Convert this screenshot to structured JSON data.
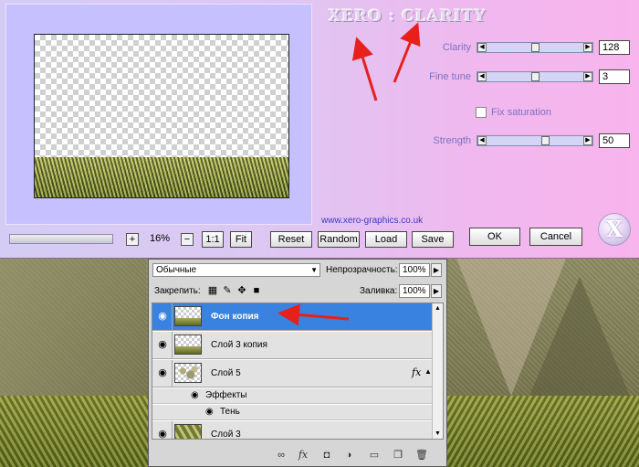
{
  "plugin": {
    "title": "XERO : CLARITY",
    "website": "www.xero-graphics.co.uk",
    "logo_letter": "X",
    "params": [
      {
        "label": "Clarity",
        "value": "128",
        "level": 0.5
      },
      {
        "label": "Fine tune",
        "value": "3",
        "level": 0.5
      },
      {
        "label": "Strength",
        "value": "50",
        "level": 0.62
      }
    ],
    "fix_saturation": {
      "label": "Fix saturation",
      "checked": false
    },
    "zoom": {
      "plus": "+",
      "value": "16%",
      "minus": "−",
      "one_to_one": "1:1",
      "fit": "Fit"
    },
    "buttons": {
      "reset": "Reset",
      "random": "Random",
      "load": "Load",
      "save": "Save",
      "ok": "OK",
      "cancel": "Cancel"
    }
  },
  "layers_panel": {
    "blend_mode": "Обычные",
    "opacity_label": "Непрозрачность:",
    "opacity_value": "100%",
    "lock_label": "Закрепить:",
    "fill_label": "Заливка:",
    "fill_value": "100%",
    "fx_label": "fx",
    "layers": [
      {
        "name": "Фон копия",
        "selected": true
      },
      {
        "name": "Слой 3 копия",
        "selected": false
      },
      {
        "name": "Слой 5",
        "selected": false,
        "has_effects": true
      },
      {
        "name": "Слой 3",
        "selected": false
      }
    ],
    "effects_label": "Эффекты",
    "shadow_label": "Тень"
  },
  "annotations": {
    "arrow_color": "#e8201c"
  },
  "colors": {
    "dialog_left": "#d4ccf4",
    "dialog_right": "#f8b4ec",
    "label_color": "#7a72c4",
    "selected_layer": "#3a82e0"
  }
}
